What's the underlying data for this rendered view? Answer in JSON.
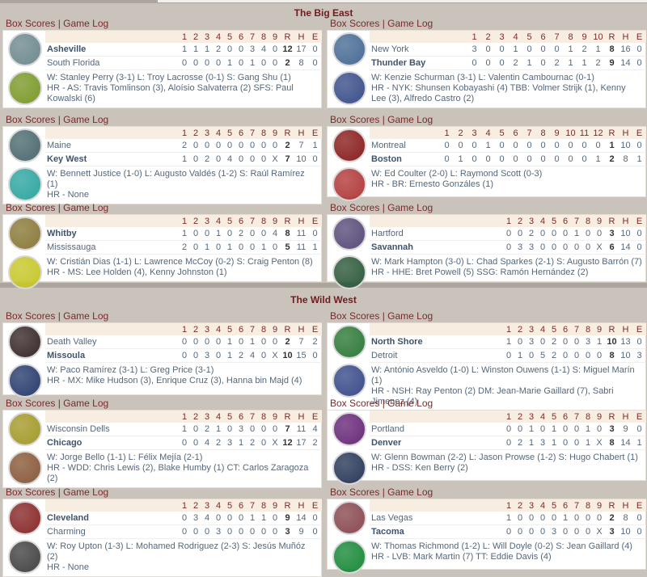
{
  "links": {
    "box": "Box Scores",
    "sep": " | ",
    "log": "Game Log"
  },
  "conferences": [
    {
      "title": "The Big East",
      "games": [
        {
          "innings": [
            "1",
            "2",
            "3",
            "4",
            "5",
            "6",
            "7",
            "8",
            "9"
          ],
          "rhe": [
            "R",
            "H",
            "E"
          ],
          "teams": [
            {
              "name": "Asheville",
              "winner": true,
              "line": [
                "1",
                "1",
                "1",
                "2",
                "0",
                "0",
                "3",
                "4",
                "0"
              ],
              "r": "12",
              "h": "17",
              "e": "0",
              "logo": "asheville-logo"
            },
            {
              "name": "South Florida",
              "winner": false,
              "line": [
                "0",
                "0",
                "0",
                "0",
                "1",
                "0",
                "1",
                "0",
                "0"
              ],
              "r": "2",
              "h": "8",
              "e": "0",
              "logo": "south-florida-logo"
            }
          ],
          "notes": [
            "W: Stanley Perry (3-1) L: Troy Lacrosse (0-1) S: Gang Shu (1)",
            "HR - AS: Travis Tomlinson (3), Aloísio Salvaterra (2) SFS: Paul Kowalski (6)"
          ]
        },
        {
          "innings": [
            "1",
            "2",
            "3",
            "4",
            "5",
            "6",
            "7",
            "8",
            "9",
            "10"
          ],
          "rhe": [
            "R",
            "H",
            "E"
          ],
          "teams": [
            {
              "name": "New York",
              "winner": false,
              "line": [
                "3",
                "0",
                "0",
                "1",
                "0",
                "0",
                "0",
                "1",
                "2",
                "1"
              ],
              "r": "8",
              "h": "16",
              "e": "0",
              "logo": "new-york-logo"
            },
            {
              "name": "Thunder Bay",
              "winner": true,
              "line": [
                "0",
                "0",
                "0",
                "2",
                "1",
                "0",
                "2",
                "1",
                "1",
                "2"
              ],
              "r": "9",
              "h": "14",
              "e": "0",
              "logo": "thunder-bay-logo"
            }
          ],
          "notes": [
            "W: Kenzie Schurman (3-1) L: Valentin Cambournac (0-1)",
            "HR - NYK: Shunsen Kobayashi (4) TBB: Volmer Strijk (1), Kenny Lee (3), Alfredo Castro (2)"
          ]
        },
        {
          "innings": [
            "1",
            "2",
            "3",
            "4",
            "5",
            "6",
            "7",
            "8",
            "9"
          ],
          "rhe": [
            "R",
            "H",
            "E"
          ],
          "teams": [
            {
              "name": "Maine",
              "winner": false,
              "line": [
                "2",
                "0",
                "0",
                "0",
                "0",
                "0",
                "0",
                "0",
                "0"
              ],
              "r": "2",
              "h": "7",
              "e": "1",
              "logo": "maine-logo"
            },
            {
              "name": "Key West",
              "winner": true,
              "line": [
                "1",
                "0",
                "2",
                "0",
                "4",
                "0",
                "0",
                "0",
                "X"
              ],
              "r": "7",
              "h": "10",
              "e": "0",
              "logo": "key-west-logo"
            }
          ],
          "notes": [
            "W: Bennett Justice (1-0) L: Augusto Valdés (1-2) S: Raúl Ramírez (1)",
            "HR - None"
          ]
        },
        {
          "innings": [
            "1",
            "2",
            "3",
            "4",
            "5",
            "6",
            "7",
            "8",
            "9",
            "10",
            "11",
            "12"
          ],
          "rhe": [
            "R",
            "H",
            "E"
          ],
          "teams": [
            {
              "name": "Montreal",
              "winner": false,
              "line": [
                "0",
                "0",
                "0",
                "1",
                "0",
                "0",
                "0",
                "0",
                "0",
                "0",
                "0",
                "0"
              ],
              "r": "1",
              "h": "10",
              "e": "0",
              "logo": "montreal-logo"
            },
            {
              "name": "Boston",
              "winner": true,
              "line": [
                "0",
                "1",
                "0",
                "0",
                "0",
                "0",
                "0",
                "0",
                "0",
                "0",
                "0",
                "1"
              ],
              "r": "2",
              "h": "8",
              "e": "1",
              "logo": "boston-logo"
            }
          ],
          "notes": [
            "W: Ed Coulter (2-0) L: Raymond Scott (0-3)",
            "HR - BR: Ernesto Gonzáles (1)"
          ]
        },
        {
          "innings": [
            "1",
            "2",
            "3",
            "4",
            "5",
            "6",
            "7",
            "8",
            "9"
          ],
          "rhe": [
            "R",
            "H",
            "E"
          ],
          "teams": [
            {
              "name": "Whitby",
              "winner": true,
              "line": [
                "1",
                "0",
                "0",
                "1",
                "0",
                "2",
                "0",
                "0",
                "4"
              ],
              "r": "8",
              "h": "11",
              "e": "0",
              "logo": "whitby-logo"
            },
            {
              "name": "Mississauga",
              "winner": false,
              "line": [
                "2",
                "0",
                "1",
                "0",
                "1",
                "0",
                "0",
                "1",
                "0"
              ],
              "r": "5",
              "h": "11",
              "e": "1",
              "logo": "mississauga-logo"
            }
          ],
          "notes": [
            "W: Cristián Dias (1-1) L: Lawrence McCoy (0-2) S: Craig Penton (8)",
            "HR - MS: Lee Holden (4), Kenny Johnston (1)"
          ]
        },
        {
          "innings": [
            "1",
            "2",
            "3",
            "4",
            "5",
            "6",
            "7",
            "8",
            "9"
          ],
          "rhe": [
            "R",
            "H",
            "E"
          ],
          "teams": [
            {
              "name": "Hartford",
              "winner": false,
              "line": [
                "0",
                "0",
                "2",
                "0",
                "0",
                "0",
                "1",
                "0",
                "0"
              ],
              "r": "3",
              "h": "10",
              "e": "0",
              "logo": "hartford-logo"
            },
            {
              "name": "Savannah",
              "winner": true,
              "line": [
                "0",
                "3",
                "3",
                "0",
                "0",
                "0",
                "0",
                "0",
                "X"
              ],
              "r": "6",
              "h": "14",
              "e": "0",
              "logo": "savannah-logo"
            }
          ],
          "notes": [
            "W: Mark Hampton (3-0) L: Chad Sparkes (2-1) S: Augusto Barrón (7)",
            "HR - HHE: Bret Powell (5) SSG: Ramón Hernández (2)"
          ]
        }
      ]
    },
    {
      "title": "The Wild West",
      "games": [
        {
          "innings": [
            "1",
            "2",
            "3",
            "4",
            "5",
            "6",
            "7",
            "8",
            "9"
          ],
          "rhe": [
            "R",
            "H",
            "E"
          ],
          "teams": [
            {
              "name": "Death Valley",
              "winner": false,
              "line": [
                "0",
                "0",
                "0",
                "0",
                "1",
                "0",
                "1",
                "0",
                "0"
              ],
              "r": "2",
              "h": "7",
              "e": "2",
              "logo": "death-valley-logo"
            },
            {
              "name": "Missoula",
              "winner": true,
              "line": [
                "0",
                "0",
                "3",
                "0",
                "1",
                "2",
                "4",
                "0",
                "X"
              ],
              "r": "10",
              "h": "15",
              "e": "0",
              "logo": "missoula-logo"
            }
          ],
          "notes": [
            "W: Paco Ramírez (3-1) L: Greg Price (3-1)",
            "HR - MX: Mike Hudson (3), Enrique Cruz (3), Hanna bin Majd (4)"
          ]
        },
        {
          "innings": [
            "1",
            "2",
            "3",
            "4",
            "5",
            "6",
            "7",
            "8",
            "9"
          ],
          "rhe": [
            "R",
            "H",
            "E"
          ],
          "teams": [
            {
              "name": "North Shore",
              "winner": true,
              "line": [
                "1",
                "0",
                "3",
                "0",
                "2",
                "0",
                "0",
                "3",
                "1"
              ],
              "r": "10",
              "h": "13",
              "e": "0",
              "logo": "north-shore-logo"
            },
            {
              "name": "Detroit",
              "winner": false,
              "line": [
                "0",
                "1",
                "0",
                "5",
                "2",
                "0",
                "0",
                "0",
                "0"
              ],
              "r": "8",
              "h": "10",
              "e": "3",
              "logo": "detroit-logo"
            }
          ],
          "notes": [
            "W: António Asveldo (1-0) L: Winston Ouwens (1-1) S: Miguel Marín (1)",
            "HR - NSH: Ray Penton (2) DM: Jean-Marie Gaillard (7), Sabri Jimenez (4)"
          ]
        },
        {
          "innings": [
            "1",
            "2",
            "3",
            "4",
            "5",
            "6",
            "7",
            "8",
            "9"
          ],
          "rhe": [
            "R",
            "H",
            "E"
          ],
          "teams": [
            {
              "name": "Wisconsin Dells",
              "winner": false,
              "line": [
                "1",
                "0",
                "2",
                "1",
                "0",
                "3",
                "0",
                "0",
                "0"
              ],
              "r": "7",
              "h": "11",
              "e": "4",
              "logo": "wisconsin-dells-logo"
            },
            {
              "name": "Chicago",
              "winner": true,
              "line": [
                "0",
                "0",
                "4",
                "2",
                "3",
                "1",
                "2",
                "0",
                "X"
              ],
              "r": "12",
              "h": "17",
              "e": "2",
              "logo": "chicago-logo"
            }
          ],
          "notes": [
            "W: Jorge Bello (1-1) L: Félix Mejía (2-1)",
            "HR - WDD: Chris Lewis (2), Blake Humby (1) CT: Carlos Zaragoza (2)"
          ]
        },
        {
          "innings": [
            "1",
            "2",
            "3",
            "4",
            "5",
            "6",
            "7",
            "8",
            "9"
          ],
          "rhe": [
            "R",
            "H",
            "E"
          ],
          "teams": [
            {
              "name": "Portland",
              "winner": false,
              "line": [
                "0",
                "0",
                "1",
                "0",
                "1",
                "0",
                "0",
                "1",
                "0"
              ],
              "r": "3",
              "h": "9",
              "e": "0",
              "logo": "portland-logo"
            },
            {
              "name": "Denver",
              "winner": true,
              "line": [
                "0",
                "2",
                "1",
                "3",
                "1",
                "0",
                "0",
                "1",
                "X"
              ],
              "r": "8",
              "h": "14",
              "e": "1",
              "logo": "denver-logo"
            }
          ],
          "notes": [
            "W: Glenn Bowman (2-2) L: Jason Prowse (1-2) S: Hugo Chabert (1)",
            "HR - DSS: Ken Berry (2)"
          ]
        },
        {
          "innings": [
            "1",
            "2",
            "3",
            "4",
            "5",
            "6",
            "7",
            "8",
            "9"
          ],
          "rhe": [
            "R",
            "H",
            "E"
          ],
          "teams": [
            {
              "name": "Cleveland",
              "winner": true,
              "line": [
                "0",
                "3",
                "4",
                "0",
                "0",
                "0",
                "1",
                "1",
                "0"
              ],
              "r": "9",
              "h": "14",
              "e": "0",
              "logo": "cleveland-logo"
            },
            {
              "name": "Charming",
              "winner": false,
              "line": [
                "0",
                "0",
                "0",
                "3",
                "0",
                "0",
                "0",
                "0",
                "0"
              ],
              "r": "3",
              "h": "9",
              "e": "0",
              "logo": "charming-logo"
            }
          ],
          "notes": [
            "W: Roy Upton (1-3) L: Mohamed Rodriguez (2-3) S: Jesús Muñóz (2)",
            "HR - None"
          ]
        },
        {
          "innings": [
            "1",
            "2",
            "3",
            "4",
            "5",
            "6",
            "7",
            "8",
            "9"
          ],
          "rhe": [
            "R",
            "H",
            "E"
          ],
          "teams": [
            {
              "name": "Las Vegas",
              "winner": false,
              "line": [
                "1",
                "0",
                "0",
                "0",
                "0",
                "1",
                "0",
                "0",
                "0"
              ],
              "r": "2",
              "h": "8",
              "e": "0",
              "logo": "las-vegas-logo"
            },
            {
              "name": "Tacoma",
              "winner": true,
              "line": [
                "0",
                "0",
                "0",
                "0",
                "3",
                "0",
                "0",
                "0",
                "X"
              ],
              "r": "3",
              "h": "10",
              "e": "0",
              "logo": "tacoma-logo"
            }
          ],
          "notes": [
            "W: Thomas Richmond (1-2) L: Will Doyle (0-2) S: Jean Gaillard (4)",
            "HR - LVB: Mark Martin (7) TT: Eddie Davis (4)"
          ]
        }
      ]
    }
  ],
  "logo_colors": {
    "asheville-logo": "#6f8a8e",
    "south-florida-logo": "#7c9a2a",
    "new-york-logo": "#4a6c96",
    "thunder-bay-logo": "#3b4f8a",
    "maine-logo": "#4d6b70",
    "key-west-logo": "#2fa6a0",
    "montreal-logo": "#8a1f1f",
    "boston-logo": "#b23b3b",
    "whitby-logo": "#8b7a3a",
    "mississauga-logo": "#c7c72a",
    "hartford-logo": "#5a4d7a",
    "savannah-logo": "#2f5a3c",
    "death-valley-logo": "#3a2a2a",
    "missoula-logo": "#2a3e6e",
    "north-shore-logo": "#2f7a3a",
    "detroit-logo": "#3a4c8a",
    "wisconsin-dells-logo": "#a49a2a",
    "chicago-logo": "#8a5a3a",
    "portland-logo": "#6a2a7a",
    "denver-logo": "#2a3a5a",
    "cleveland-logo": "#8a2a2a",
    "charming-logo": "#444444",
    "las-vegas-logo": "#8a4a52",
    "tacoma-logo": "#1a8a3a"
  }
}
